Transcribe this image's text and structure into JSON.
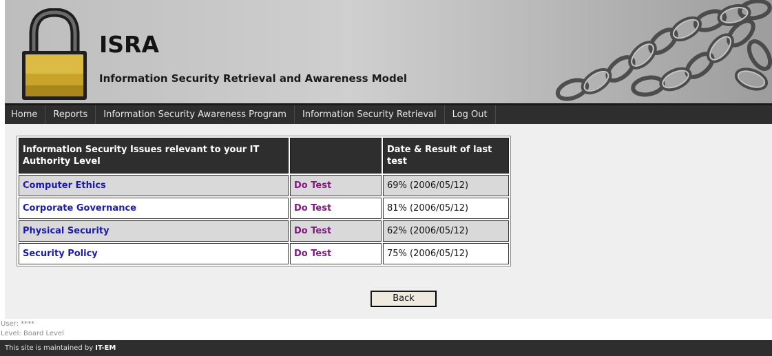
{
  "header": {
    "title": "ISRA",
    "subtitle": "Information Security Retrieval and Awareness Model",
    "logo_icon": "padlock-icon",
    "decoration": "chains-image"
  },
  "nav": {
    "items": [
      {
        "label": "Home"
      },
      {
        "label": "Reports"
      },
      {
        "label": "Information Security Awareness Program"
      },
      {
        "label": "Information Security Retrieval"
      },
      {
        "label": "Log Out"
      }
    ]
  },
  "table": {
    "headers": [
      "Information Security Issues relevant to your IT Authority Level",
      "",
      "Date & Result of last test"
    ],
    "rows": [
      {
        "topic": "Computer Ethics",
        "action": "Do Test",
        "result": "69% (2006/05/12)"
      },
      {
        "topic": "Corporate Governance",
        "action": "Do Test",
        "result": "81% (2006/05/12)"
      },
      {
        "topic": "Physical Security",
        "action": "Do Test",
        "result": "62% (2006/05/12)"
      },
      {
        "topic": "Security Policy",
        "action": "Do Test",
        "result": "75% (2006/05/12)"
      }
    ]
  },
  "back_button": {
    "label": "Back"
  },
  "user_info": {
    "user": "User: ****",
    "level": "Level: Board Level"
  },
  "footer": {
    "prefix": "This site is maintained by ",
    "org": "IT-EM"
  },
  "colors": {
    "dark_bar": "#2e2e2e",
    "topic_link": "#1a1ab0",
    "test_link": "#7d1a7d",
    "content_bg": "#efefef"
  }
}
